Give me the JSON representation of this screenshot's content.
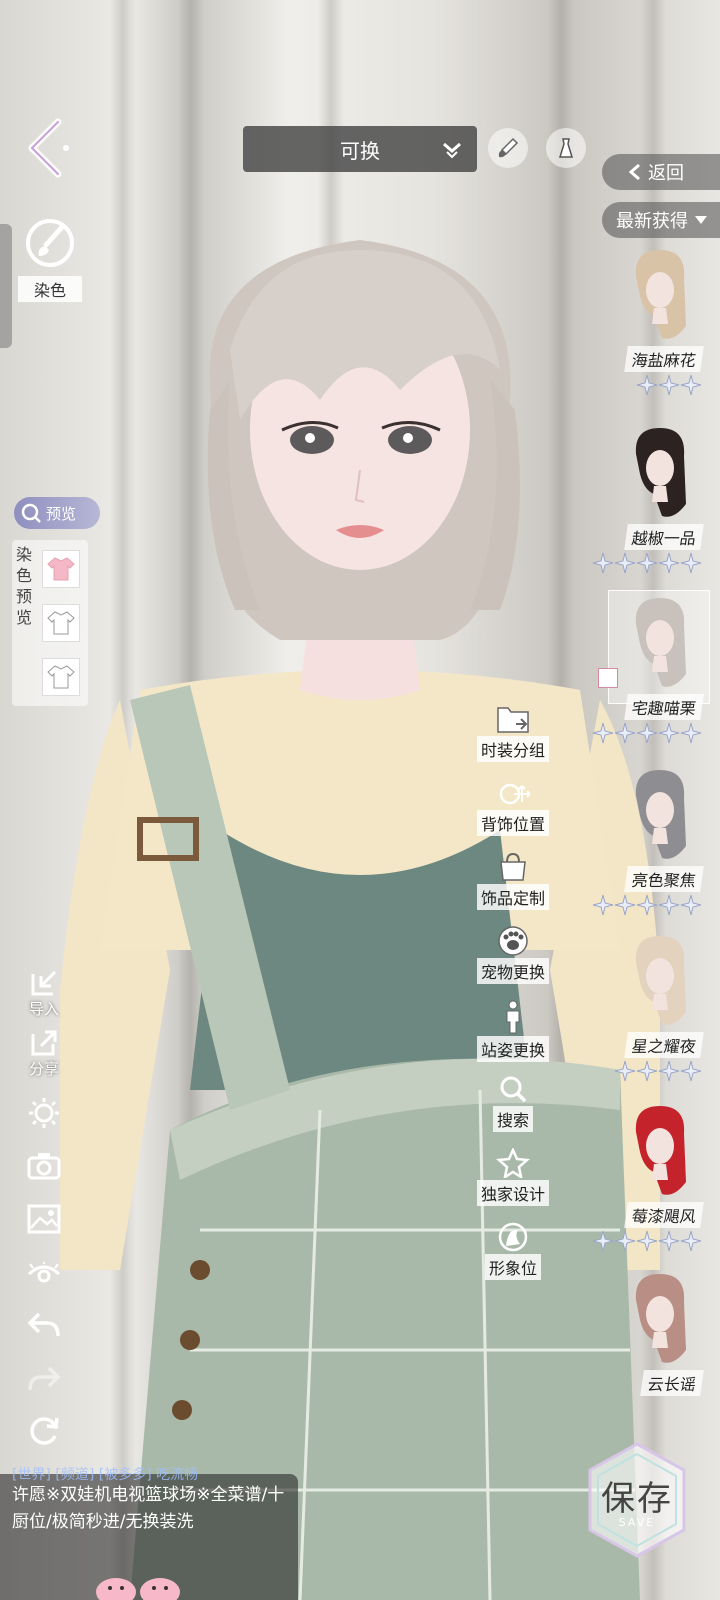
{
  "top_bar": {
    "dropdown_label": "可换",
    "icons": [
      "brush-icon",
      "dress-icon"
    ]
  },
  "left_panel": {
    "dye_label": "染色",
    "preview_label": "预览",
    "dye_preview_label": "染色预览"
  },
  "left_tools": [
    {
      "icon": "import-icon",
      "label": "导入"
    },
    {
      "icon": "share-icon",
      "label": "分享"
    },
    {
      "icon": "sun-icon",
      "label": ""
    },
    {
      "icon": "camera-icon",
      "label": ""
    },
    {
      "icon": "image-icon",
      "label": ""
    },
    {
      "icon": "eye-icon",
      "label": ""
    },
    {
      "icon": "undo-icon",
      "label": ""
    },
    {
      "icon": "redo-icon",
      "label": ""
    },
    {
      "icon": "reset-icon",
      "label": ""
    }
  ],
  "actions": [
    {
      "icon": "folder-icon",
      "label": "时装分组"
    },
    {
      "icon": "move-icon",
      "label": "背饰位置"
    },
    {
      "icon": "bag-icon",
      "label": "饰品定制"
    },
    {
      "icon": "paw-icon",
      "label": "宠物更换"
    },
    {
      "icon": "figure-icon",
      "label": "站姿更换"
    },
    {
      "icon": "search-icon",
      "label": "搜索"
    },
    {
      "icon": "star-icon",
      "label": "独家设计"
    },
    {
      "icon": "portrait-icon",
      "label": "形象位"
    }
  ],
  "right_panel": {
    "return_label": "返回",
    "sort_label": "最新获得",
    "hairstyles": [
      {
        "name": "海盐麻花",
        "stars": 3,
        "hair_color": "#d9c3a6",
        "selected": false
      },
      {
        "name": "越椒一品",
        "stars": 5,
        "hair_color": "#2b2221",
        "selected": false
      },
      {
        "name": "宅趣喵栗",
        "stars": 5,
        "hair_color": "#c9c1bb",
        "selected": true
      },
      {
        "name": "亮色聚焦",
        "stars": 5,
        "hair_color": "#8e8e92",
        "selected": false
      },
      {
        "name": "星之耀夜",
        "stars": 4,
        "hair_color": "#e3d2bd",
        "selected": false
      },
      {
        "name": "莓漆飓风",
        "stars": 5,
        "hair_color": "#c4232c",
        "selected": false
      },
      {
        "name": "云长谣",
        "stars": 0,
        "hair_color": "#b98e84",
        "selected": false
      }
    ]
  },
  "chat": {
    "faint_line": "[世界] [频道] [被多多] 吃流畅",
    "message": "许愿※双娃机电视篮球场※全菜谱/十厨位/极简秒进/无换装洗"
  },
  "save": {
    "label": "保存",
    "sub": "SAVE"
  },
  "colors": {
    "accent": "#8f8fbf",
    "hair": "#d4ccc6",
    "sweater": "#f4e6c4",
    "dress": "#6d8a80"
  }
}
